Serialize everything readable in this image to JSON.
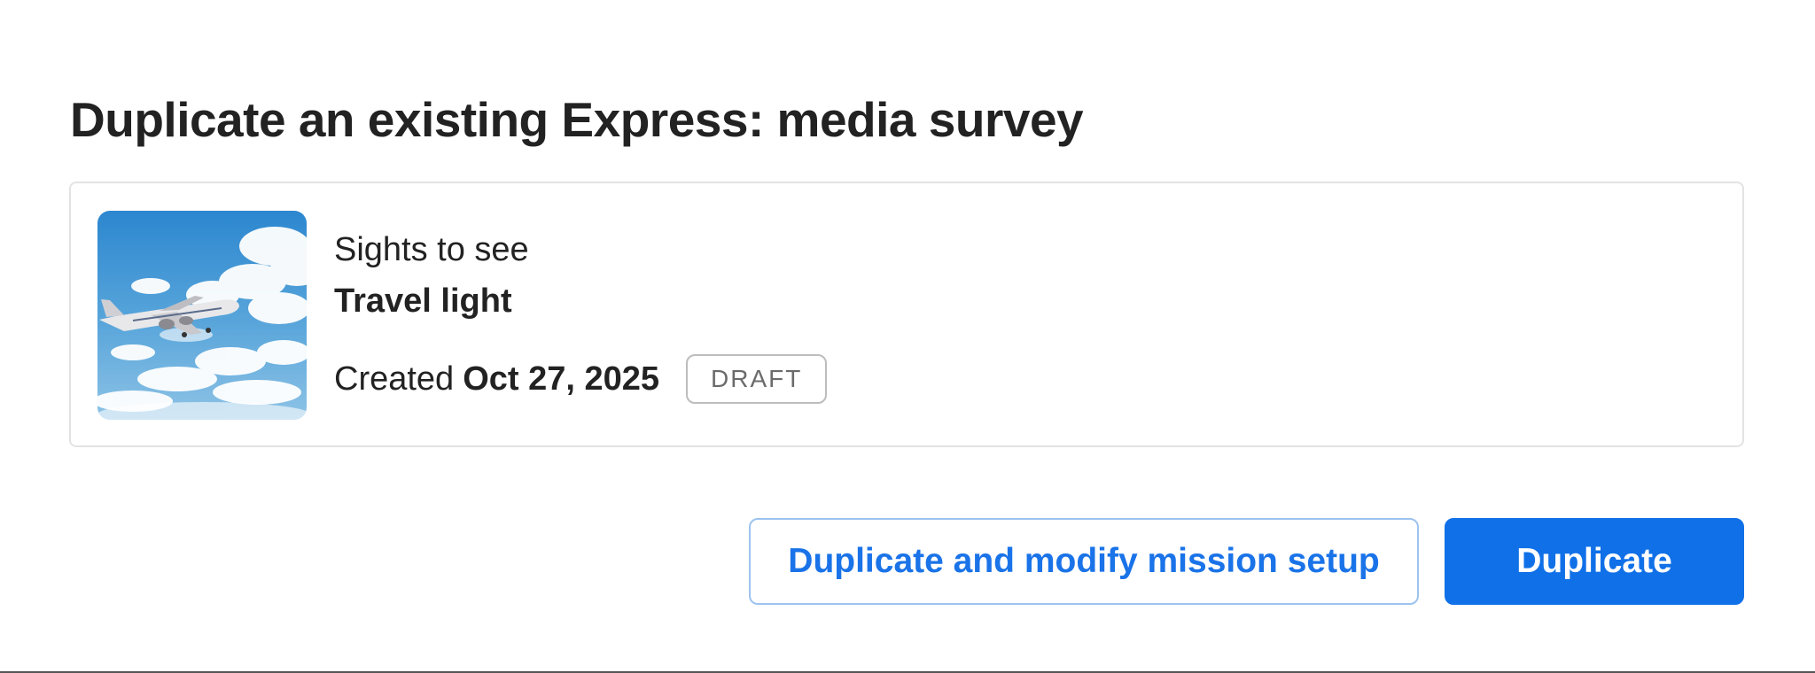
{
  "page": {
    "title": "Duplicate an existing Express: media survey"
  },
  "mission": {
    "subtitle": "Sights to see",
    "title": "Travel light",
    "created_label": "Created",
    "created_date": "Oct 27, 2025",
    "status": "DRAFT",
    "thumbnail": "airplane-in-sky-image"
  },
  "actions": {
    "modify_label": "Duplicate and modify mission setup",
    "duplicate_label": "Duplicate"
  },
  "colors": {
    "accent": "#1070e8",
    "secondary_border": "#9dc3ef",
    "badge_border": "#bdbdbd",
    "card_border": "#e3e3e3"
  }
}
